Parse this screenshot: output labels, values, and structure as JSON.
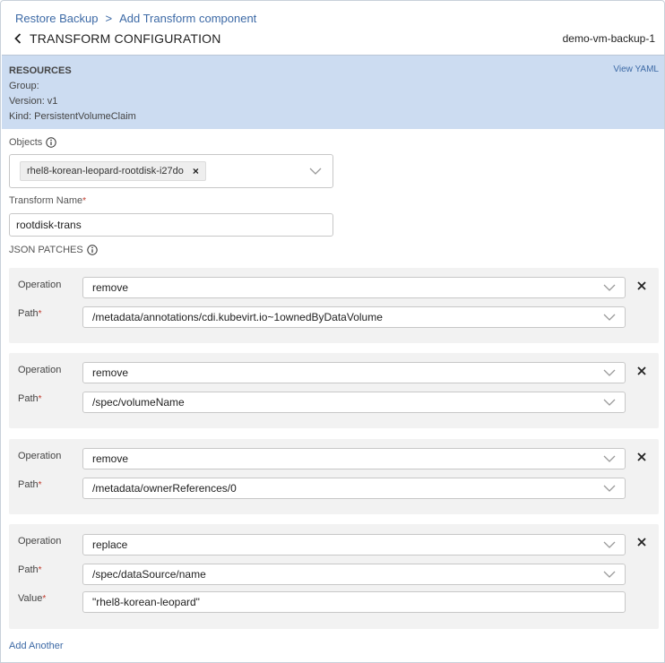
{
  "breadcrumb": {
    "root": "Restore Backup",
    "separator": ">",
    "current": "Add Transform component"
  },
  "header": {
    "title": "TRANSFORM CONFIGURATION",
    "vm_name": "demo-vm-backup-1"
  },
  "resources": {
    "heading": "RESOURCES",
    "group": "Group:",
    "version": "Version: v1",
    "kind": "Kind: PersistentVolumeClaim",
    "view_yaml": "View YAML"
  },
  "objects": {
    "label": "Objects",
    "chip": "rhel8-korean-leopard-rootdisk-i27do"
  },
  "transform_name": {
    "label": "Transform Name",
    "required": "*",
    "value": "rootdisk-trans"
  },
  "json_patches": {
    "label": "JSON PATCHES",
    "operation_label": "Operation",
    "path_label": "Path",
    "value_label": "Value",
    "required": "*",
    "patches": [
      {
        "operation": "remove",
        "path": "/metadata/annotations/cdi.kubevirt.io~1ownedByDataVolume"
      },
      {
        "operation": "remove",
        "path": "/spec/volumeName"
      },
      {
        "operation": "remove",
        "path": "/metadata/ownerReferences/0"
      },
      {
        "operation": "replace",
        "path": "/spec/dataSource/name",
        "value": "\"rhel8-korean-leopard\""
      }
    ]
  },
  "add_another": "Add Another",
  "icons": {
    "back": "chevron-left-icon",
    "info": "info-icon",
    "chevron": "chevron-down-icon",
    "remove": "close-icon"
  },
  "colors": {
    "link": "#3d6aa6",
    "resources_bg": "#ccdcf1",
    "patch_bg": "#f2f2f2",
    "required": "#c0392b"
  }
}
